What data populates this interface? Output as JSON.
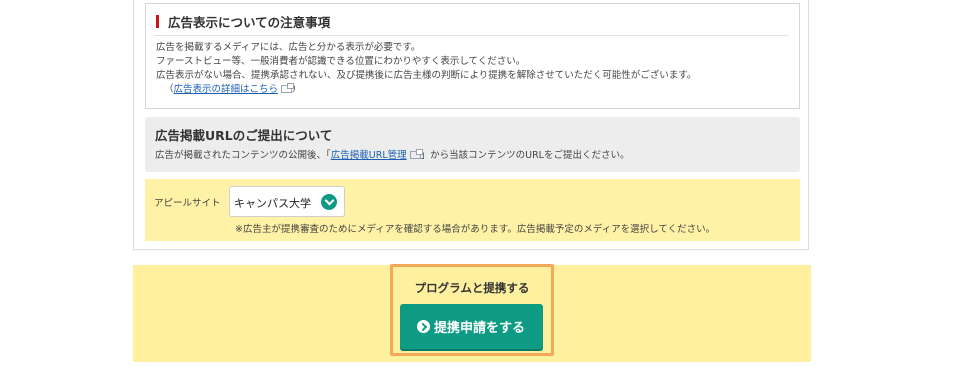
{
  "notice": {
    "title": "広告表示についての注意事項",
    "lines": [
      "広告を掲載するメディアには、広告と分かる表示が必要です。",
      "ファーストビュー等、一般消費者が認識できる位置にわかりやすく表示してください。",
      "広告表示がない場合、提携承認されない、及び提携後に広告主様の判断により提携を解除させていただく可能性がございます。"
    ],
    "link_prefix": "（",
    "link_text": "広告表示の詳細はこちら",
    "link_suffix": "）"
  },
  "url_section": {
    "title": "広告掲載URLのご提出について",
    "desc_prefix": "広告が掲載されたコンテンツの公開後、「",
    "link_text": "広告掲載URL管理",
    "desc_suffix": "」から当該コンテンツのURLをご提出ください。"
  },
  "appeal": {
    "label": "アピールサイト",
    "selected_value": "キャンパス大学",
    "note": "※広告主が提携審査のためにメディアを確認する場合があります。広告掲載予定のメディアを選択してください。"
  },
  "cta": {
    "heading": "プログラムと提携する",
    "button_label": "提携申請をする"
  },
  "colors": {
    "accent_red": "#c8161d",
    "button_green": "#0d9b84",
    "highlight_yellow": "#fff0a0",
    "focus_orange": "#f3a85a",
    "link_blue": "#1a5fb4"
  },
  "icons": {
    "external_link": "external-link-icon",
    "dropdown": "chevron-down-icon",
    "button": "arrow-right-circle-icon"
  }
}
